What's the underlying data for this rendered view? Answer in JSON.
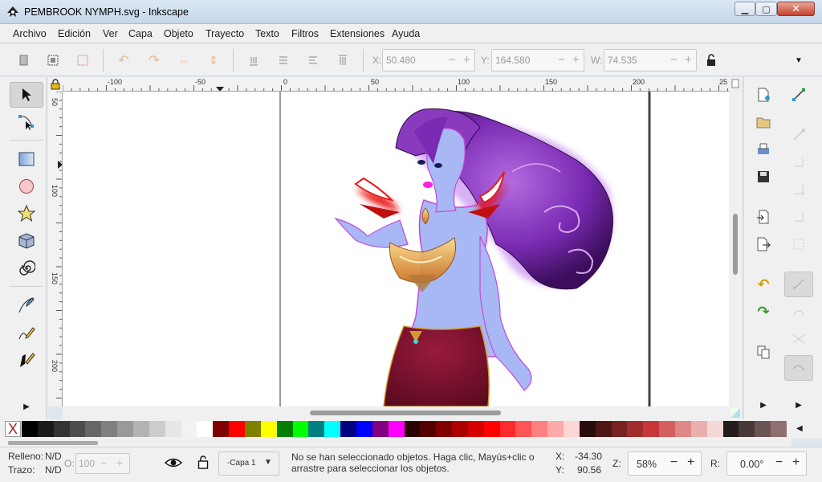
{
  "window": {
    "title": "PEMBROOK NYMPH.svg - Inkscape",
    "minimize": "▁",
    "maximize": "▢",
    "close": "✕"
  },
  "menu": [
    "Archivo",
    "Edición",
    "Ver",
    "Capa",
    "Objeto",
    "Trayecto",
    "Texto",
    "Filtros",
    "Extensiones",
    "Ayuda"
  ],
  "tool_controls": {
    "x_label": "X:",
    "x_value": "50.480",
    "y_label": "Y:",
    "y_value": "164.580",
    "w_label": "W:",
    "w_value": "74.535",
    "minus": "−",
    "plus": "+"
  },
  "rulers": {
    "horizontal": [
      "-100",
      "-50",
      "0",
      "50",
      "100",
      "150",
      "200",
      "25"
    ],
    "vertical": [
      "50",
      "100",
      "150",
      "200"
    ]
  },
  "palette": {
    "none_label": "X",
    "colors": [
      "#000000",
      "#1a1a1a",
      "#333333",
      "#4d4d4d",
      "#666666",
      "#808080",
      "#999999",
      "#b3b3b3",
      "#cccccc",
      "#e6e6e6",
      "#f2f2f2",
      "#ffffff",
      "#800000",
      "#ff0000",
      "#808000",
      "#ffff00",
      "#008000",
      "#00ff00",
      "#008080",
      "#00ffff",
      "#000080",
      "#0000ff",
      "#800080",
      "#ff00ff",
      "#2b0000",
      "#550000",
      "#800000",
      "#aa0000",
      "#d40000",
      "#ff0000",
      "#ff2a2a",
      "#ff5555",
      "#ff8080",
      "#ffaaaa",
      "#ffd5d5",
      "#280b0b",
      "#501616",
      "#782121",
      "#a02c2c",
      "#c83737",
      "#d35f5f",
      "#de8787",
      "#e9afaf",
      "#f4d7d7",
      "#241c1c",
      "#483737",
      "#6c5353",
      "#916f6f"
    ]
  },
  "status": {
    "fill_label": "Relleno:",
    "fill_value": "N/D",
    "stroke_label": "Trazo:",
    "stroke_value": "N/D",
    "opacity_label": "O:",
    "opacity_value": "100",
    "layer": "-Capa 1",
    "message": "No se han seleccionado objetos. Haga clic, Mayús+clic o arrastre para seleccionar los objetos.",
    "message_line1": "No se han seleccionado objetos. Haga clic, Mayús+clic o",
    "message_line2": "arrastre para seleccionar los objetos.",
    "cursor_x_label": "X:",
    "cursor_x": "-34.30",
    "cursor_y_label": "Y:",
    "cursor_y": "90.56",
    "zoom_label": "Z:",
    "zoom": "58%",
    "rotation_label": "R:",
    "rotation": "0.00°"
  },
  "colors": {
    "hair": "#8a3bbd",
    "skin": "#a8b8f4",
    "skirt": "#7a0f2c",
    "gold": "#e0a030",
    "glow": "#e81818"
  }
}
